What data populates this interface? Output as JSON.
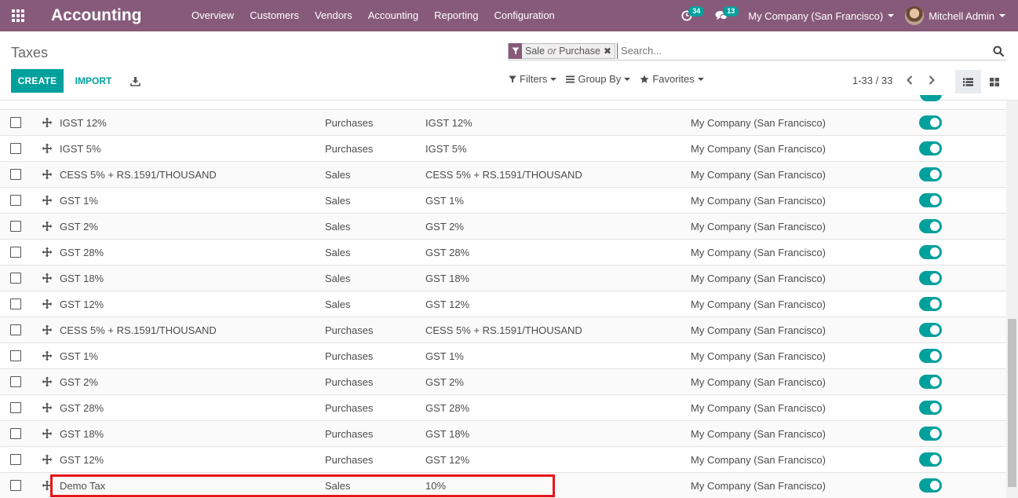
{
  "navbar": {
    "app_name": "Accounting",
    "menu": [
      "Overview",
      "Customers",
      "Vendors",
      "Accounting",
      "Reporting",
      "Configuration"
    ],
    "activity_count": "34",
    "messages_count": "13",
    "company": "My Company (San Francisco)",
    "user": "Mitchell Admin"
  },
  "control": {
    "title": "Taxes",
    "facet_part1": "Sale",
    "facet_or": "or",
    "facet_part2": "Purchase",
    "search_placeholder": "Search...",
    "create_label": "CREATE",
    "import_label": "IMPORT",
    "filters_label": "Filters",
    "groupby_label": "Group By",
    "favorites_label": "Favorites",
    "pager": "1-33 / 33"
  },
  "colors": {
    "navbar": "#875a7b",
    "accent": "#00a09d",
    "highlight": "#e8141a"
  },
  "rows": [
    {
      "name": "IGST 12%",
      "type": "Purchases",
      "label": "IGST 12%",
      "company": "My Company (San Francisco)",
      "active": true
    },
    {
      "name": "IGST 5%",
      "type": "Purchases",
      "label": "IGST 5%",
      "company": "My Company (San Francisco)",
      "active": true
    },
    {
      "name": "CESS 5% + RS.1591/THOUSAND",
      "type": "Sales",
      "label": "CESS 5% + RS.1591/THOUSAND",
      "company": "My Company (San Francisco)",
      "active": true
    },
    {
      "name": "GST 1%",
      "type": "Sales",
      "label": "GST 1%",
      "company": "My Company (San Francisco)",
      "active": true
    },
    {
      "name": "GST 2%",
      "type": "Sales",
      "label": "GST 2%",
      "company": "My Company (San Francisco)",
      "active": true
    },
    {
      "name": "GST 28%",
      "type": "Sales",
      "label": "GST 28%",
      "company": "My Company (San Francisco)",
      "active": true
    },
    {
      "name": "GST 18%",
      "type": "Sales",
      "label": "GST 18%",
      "company": "My Company (San Francisco)",
      "active": true
    },
    {
      "name": "GST 12%",
      "type": "Sales",
      "label": "GST 12%",
      "company": "My Company (San Francisco)",
      "active": true
    },
    {
      "name": "CESS 5% + RS.1591/THOUSAND",
      "type": "Purchases",
      "label": "CESS 5% + RS.1591/THOUSAND",
      "company": "My Company (San Francisco)",
      "active": true
    },
    {
      "name": "GST 1%",
      "type": "Purchases",
      "label": "GST 1%",
      "company": "My Company (San Francisco)",
      "active": true
    },
    {
      "name": "GST 2%",
      "type": "Purchases",
      "label": "GST 2%",
      "company": "My Company (San Francisco)",
      "active": true
    },
    {
      "name": "GST 28%",
      "type": "Purchases",
      "label": "GST 28%",
      "company": "My Company (San Francisco)",
      "active": true
    },
    {
      "name": "GST 18%",
      "type": "Purchases",
      "label": "GST 18%",
      "company": "My Company (San Francisco)",
      "active": true
    },
    {
      "name": "GST 12%",
      "type": "Purchases",
      "label": "GST 12%",
      "company": "My Company (San Francisco)",
      "active": true
    },
    {
      "name": "Demo Tax",
      "type": "Sales",
      "label": "10%",
      "company": "My Company (San Francisco)",
      "active": true
    }
  ]
}
